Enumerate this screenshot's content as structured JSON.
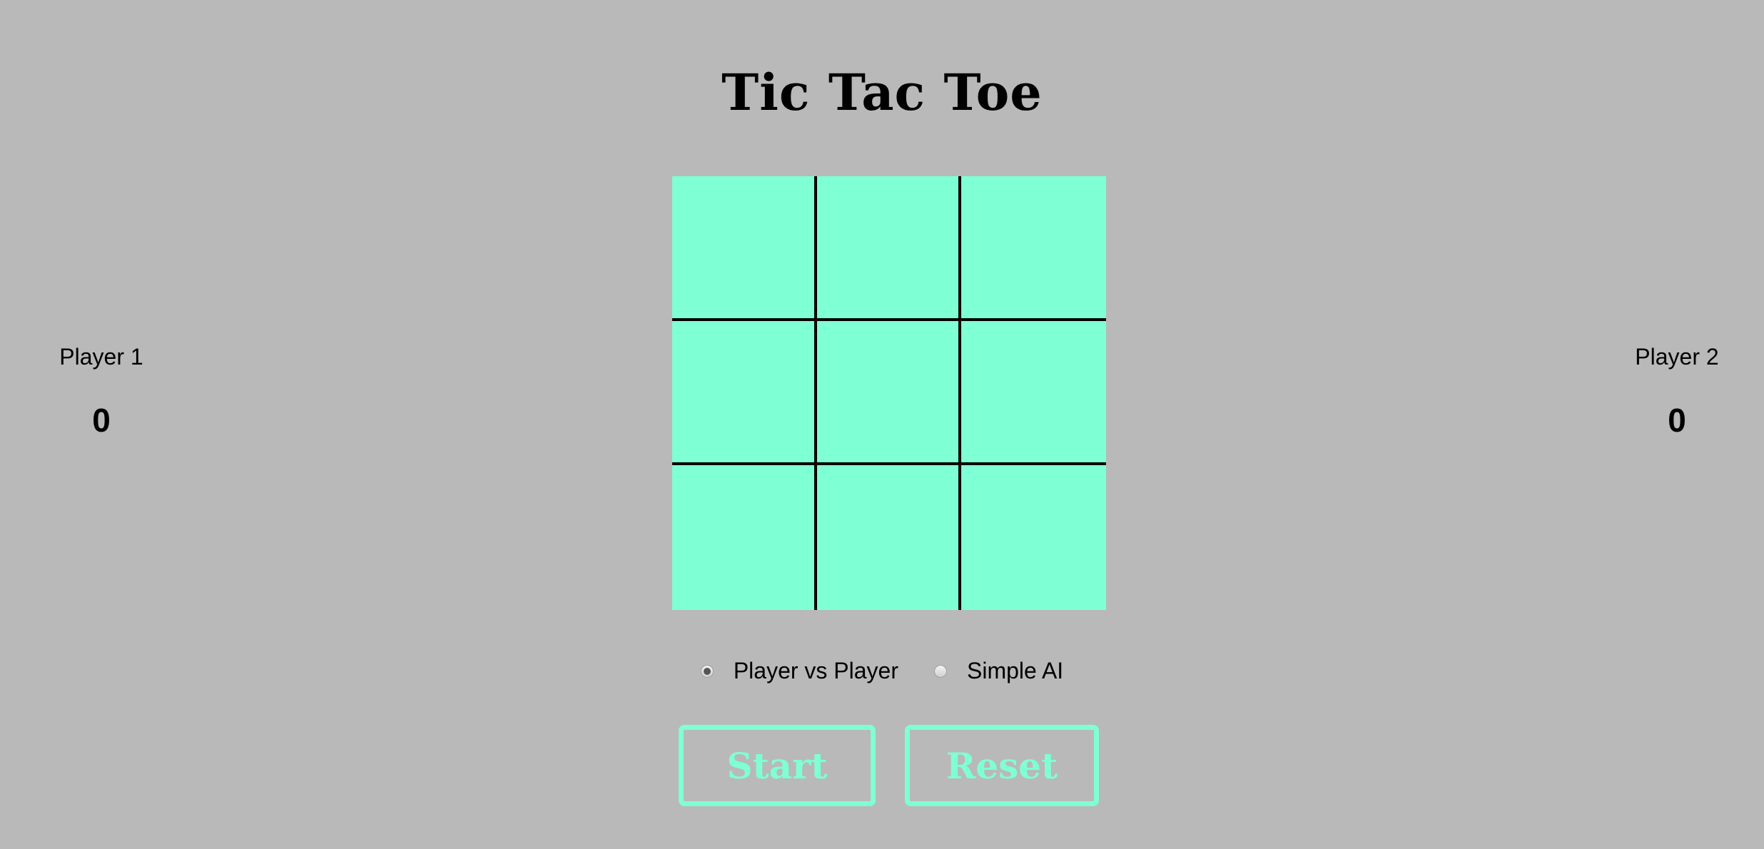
{
  "title": "Tic Tac Toe",
  "players": [
    {
      "name": "Player 1",
      "score": "0"
    },
    {
      "name": "Player 2",
      "score": "0"
    }
  ],
  "board": {
    "cells": [
      "",
      "",
      "",
      "",
      "",
      "",
      "",
      "",
      ""
    ],
    "cell_color": "#7fffd4",
    "line_color": "#000000"
  },
  "modes": [
    {
      "label": "Player vs Player",
      "selected": true
    },
    {
      "label": "Simple AI",
      "selected": false
    }
  ],
  "buttons": {
    "start_label": "Start",
    "reset_label": "Reset",
    "accent_color": "#7fffd4"
  },
  "background_color": "#b9b9b9"
}
